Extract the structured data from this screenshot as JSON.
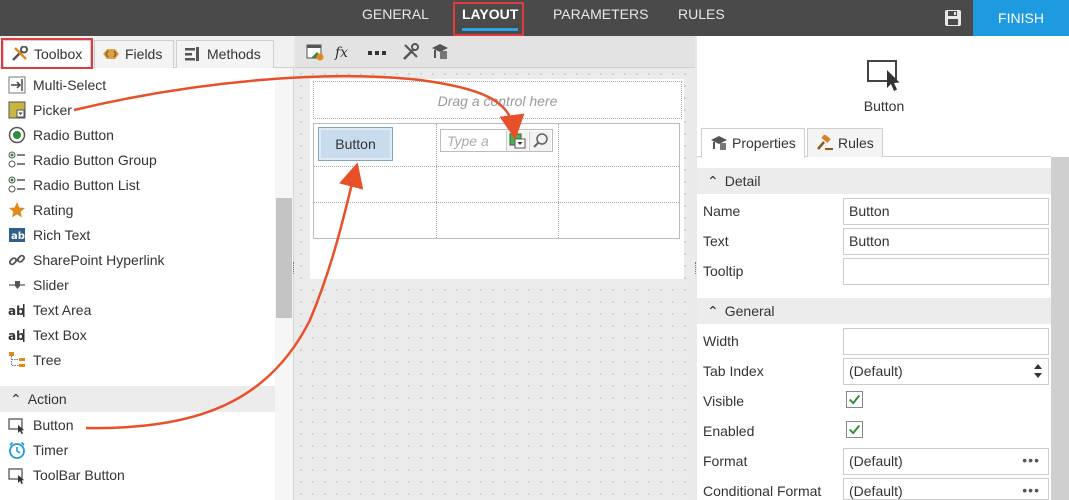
{
  "nav": {
    "tabs": [
      "GENERAL",
      "LAYOUT",
      "PARAMETERS",
      "RULES"
    ],
    "active": "LAYOUT",
    "finish_label": "FINISH"
  },
  "toolbox": {
    "tabs": [
      "Toolbox",
      "Fields",
      "Methods"
    ],
    "active_tab": "Toolbox",
    "items": [
      "Multi-Select",
      "Picker",
      "Radio Button",
      "Radio Button Group",
      "Radio Button List",
      "Rating",
      "Rich Text",
      "SharePoint Hyperlink",
      "Slider",
      "Text Area",
      "Text Box",
      "Tree"
    ],
    "action_section": "Action",
    "action_items": [
      "Button",
      "Timer",
      "ToolBar Button"
    ]
  },
  "canvas": {
    "drag_hint": "Drag a control here",
    "button_label": "Button",
    "picker_placeholder": "Type a"
  },
  "properties": {
    "control_name": "Button",
    "tabs": [
      "Properties",
      "Rules"
    ],
    "detail_section": "Detail",
    "general_section": "General",
    "detail_fields": [
      {
        "label": "Name",
        "value": "Button"
      },
      {
        "label": "Text",
        "value": "Button"
      },
      {
        "label": "Tooltip",
        "value": ""
      }
    ],
    "general_fields": [
      {
        "label": "Width",
        "value": ""
      },
      {
        "label": "Tab Index",
        "value": "(Default)"
      },
      {
        "label": "Visible",
        "checked": true
      },
      {
        "label": "Enabled",
        "checked": true
      },
      {
        "label": "Format",
        "value": "(Default)"
      },
      {
        "label": "Conditional Format",
        "value": "(Default)"
      }
    ]
  },
  "colors": {
    "accent": "#1e9be0",
    "highlight": "#e0393e",
    "arrow": "#e8502a",
    "check": "#2e8b3a"
  }
}
